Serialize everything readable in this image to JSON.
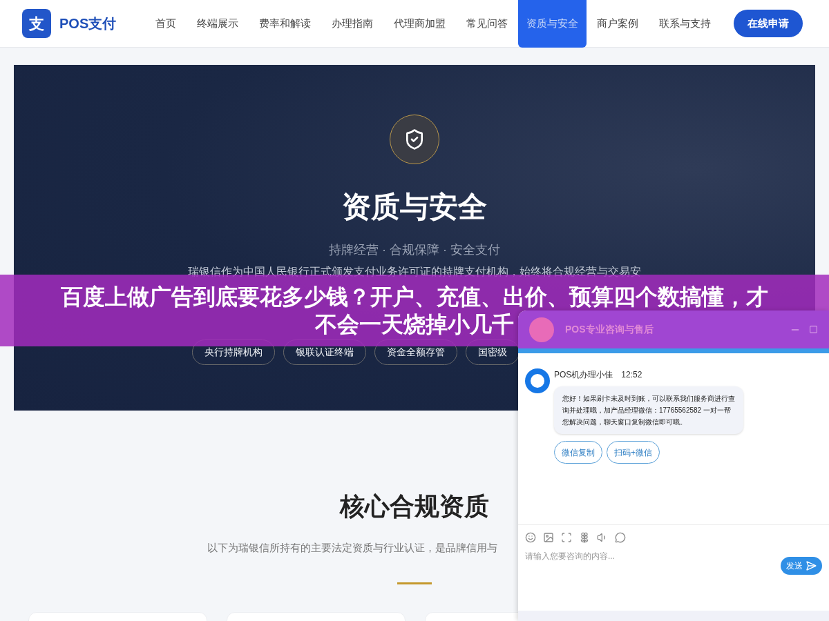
{
  "nav": {
    "logo_mark": "支",
    "logo_text": "POS支付",
    "items": [
      {
        "label": "首页",
        "selected": false
      },
      {
        "label": "终端展示",
        "selected": false
      },
      {
        "label": "费率和解读",
        "selected": false
      },
      {
        "label": "办理指南",
        "selected": false
      },
      {
        "label": "代理商加盟",
        "selected": false
      },
      {
        "label": "常见问答",
        "selected": false
      },
      {
        "label": "资质与安全",
        "selected": true
      },
      {
        "label": "商户案例",
        "selected": false
      },
      {
        "label": "联系与支持",
        "selected": false
      }
    ],
    "cta": "在线申请"
  },
  "hero": {
    "title": "资质与安全",
    "subtitle": "持牌经营 · 合规保障 · 安全支付",
    "paragraph_lines": [
      "瑞银信作为中国人民银行正式颁发支付业务许可证的持牌支付机构，始终将合规经营与交易安"
    ],
    "badges": [
      "央行持牌机构",
      "银联认证终端",
      "资金全额存管",
      "国密级"
    ]
  },
  "section": {
    "title": "核心合规资质",
    "subtitle": "以下为瑞银信所持有的主要法定资质与行业认证，是品牌信用与"
  },
  "banner": {
    "lines": [
      "百度上做广告到底要花多少钱？开户、充值、出价、预算四个数搞懂，才",
      "不会一天烧掉小几千"
    ]
  },
  "chat": {
    "title": "POS专业咨询与售后",
    "sender": "POS机办理小佳",
    "time": "12:52",
    "message": "您好！如果刷卡未及时到账，可以联系我们服务商进行查询并处理哦，加产品经理微信：17765562582 一对一帮您解决问题，聊天窗口复制微信即可哦。",
    "actions": [
      "微信复制",
      "扫码+微信"
    ],
    "input": {
      "placeholder": "请输入您要咨询的内容..."
    },
    "send": "发送"
  }
}
